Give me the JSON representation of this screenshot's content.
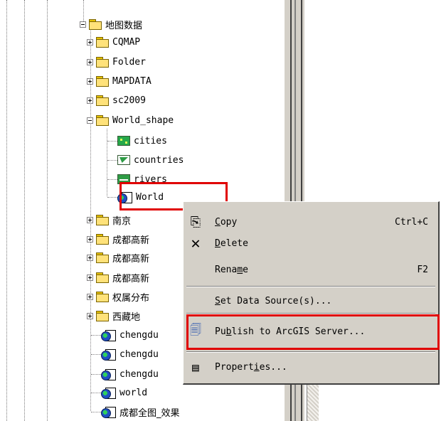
{
  "tree": {
    "root_label": "地图数据",
    "items": [
      {
        "label": "CQMAP",
        "kind": "folder"
      },
      {
        "label": "Folder",
        "kind": "folder"
      },
      {
        "label": "MAPDATA",
        "kind": "folder"
      },
      {
        "label": "sc2009",
        "kind": "folder"
      },
      {
        "label": "World_shape",
        "kind": "folder"
      }
    ],
    "world_shape_children": [
      {
        "label": "cities",
        "kind": "point-layer"
      },
      {
        "label": "countries",
        "kind": "polygon-layer"
      },
      {
        "label": "rivers",
        "kind": "line-layer"
      },
      {
        "label": "World",
        "kind": "map-document"
      }
    ],
    "after_items": [
      {
        "label": "南京",
        "kind": "folder"
      },
      {
        "label": "成都高新",
        "kind": "folder"
      },
      {
        "label": "成都高新",
        "kind": "folder"
      },
      {
        "label": "成都高新",
        "kind": "folder"
      },
      {
        "label": "权属分布",
        "kind": "folder"
      },
      {
        "label": "西藏地",
        "kind": "folder"
      },
      {
        "label": "chengdu",
        "kind": "map-document"
      },
      {
        "label": "chengdu",
        "kind": "map-document"
      },
      {
        "label": "chengdu",
        "kind": "map-document"
      },
      {
        "label": "world",
        "kind": "map-document"
      },
      {
        "label": "成都全图_效果",
        "kind": "map-document"
      }
    ]
  },
  "context_menu": {
    "copy": {
      "pre": "",
      "u": "C",
      "post": "opy",
      "shortcut": "Ctrl+C",
      "icon": "copy-icon"
    },
    "delete": {
      "pre": "",
      "u": "D",
      "post": "elete",
      "icon": "delete-x-icon"
    },
    "rename": {
      "pre": "Rena",
      "u": "m",
      "post": "e",
      "shortcut": "F2"
    },
    "set_data_source": {
      "pre": "",
      "u": "S",
      "post": "et Data Source(s)..."
    },
    "publish": {
      "pre": "Pu",
      "u": "b",
      "post": "lish to ArcGIS Server...",
      "icon": "publish-server-icon"
    },
    "properties": {
      "pre": "Propert",
      "u": "i",
      "post": "es...",
      "icon": "properties-icon"
    }
  },
  "colors": {
    "highlight": "#e00000",
    "menu_bg": "#d4d0c8"
  }
}
